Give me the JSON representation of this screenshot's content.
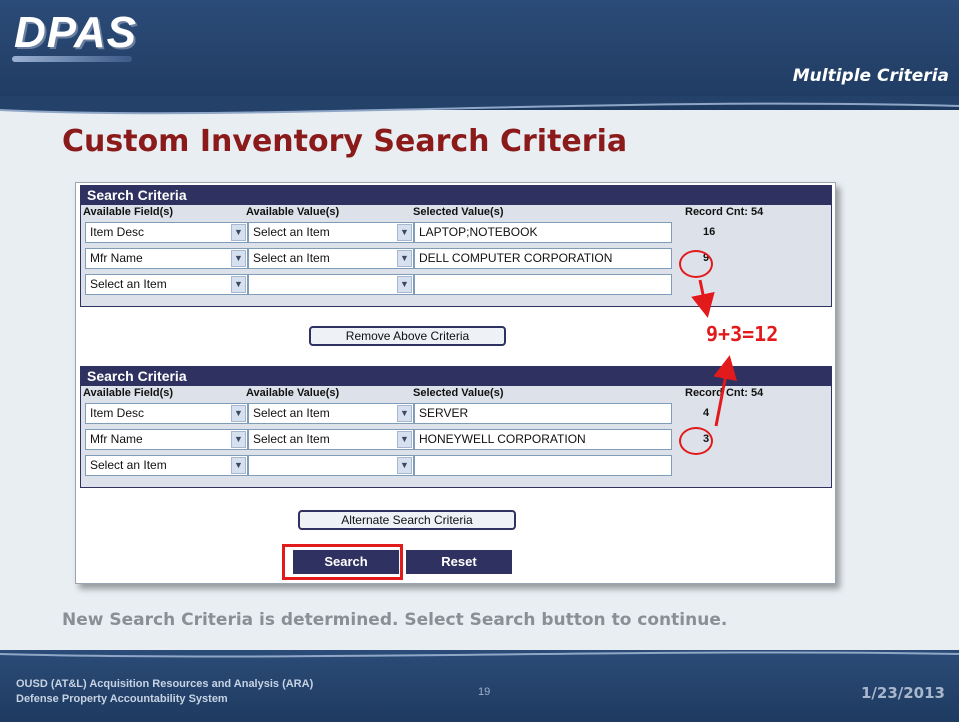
{
  "header": {
    "logo": "DPAS",
    "subtitle": "Multiple Criteria"
  },
  "slide": {
    "title": "Custom Inventory Search Criteria",
    "instruction": "New Search Criteria is determined.  Select Search button to continue.",
    "annotation": "9+3=12"
  },
  "colors": {
    "header_blue": "#24416a",
    "title_red": "#8b1a1a",
    "panel_navy": "#2f3160",
    "annotation_red": "#e31a1c"
  },
  "criteria1": {
    "header": "Search Criteria",
    "col_fields": "Available Field(s)",
    "col_values": "Available Value(s)",
    "col_selected": "Selected Value(s)",
    "record_cnt": "Record Cnt: 54",
    "rows": [
      {
        "field": "Item Desc",
        "value": "Select an Item",
        "selected": "LAPTOP;NOTEBOOK",
        "count": "16"
      },
      {
        "field": "Mfr Name",
        "value": "Select an Item",
        "selected": "DELL COMPUTER CORPORATION",
        "count": "9"
      },
      {
        "field": "Select an Item",
        "value": "",
        "selected": "",
        "count": ""
      }
    ]
  },
  "remove_button": "Remove Above Criteria",
  "criteria2": {
    "header": "Search Criteria",
    "col_fields": "Available Field(s)",
    "col_values": "Available Value(s)",
    "col_selected": "Selected Value(s)",
    "record_cnt": "Record Cnt: 54",
    "rows": [
      {
        "field": "Item Desc",
        "value": "Select an Item",
        "selected": "SERVER",
        "count": "4"
      },
      {
        "field": "Mfr Name",
        "value": "Select an Item",
        "selected": "HONEYWELL CORPORATION",
        "count": "3"
      },
      {
        "field": "Select an Item",
        "value": "",
        "selected": "",
        "count": ""
      }
    ]
  },
  "alternate_button": "Alternate Search Criteria",
  "search_button": "Search",
  "reset_button": "Reset",
  "footer": {
    "line1": "OUSD (AT&L) Acquisition Resources and Analysis (ARA)",
    "line2": "Defense Property Accountability System",
    "page_number": "19",
    "date": "1/23/2013"
  }
}
